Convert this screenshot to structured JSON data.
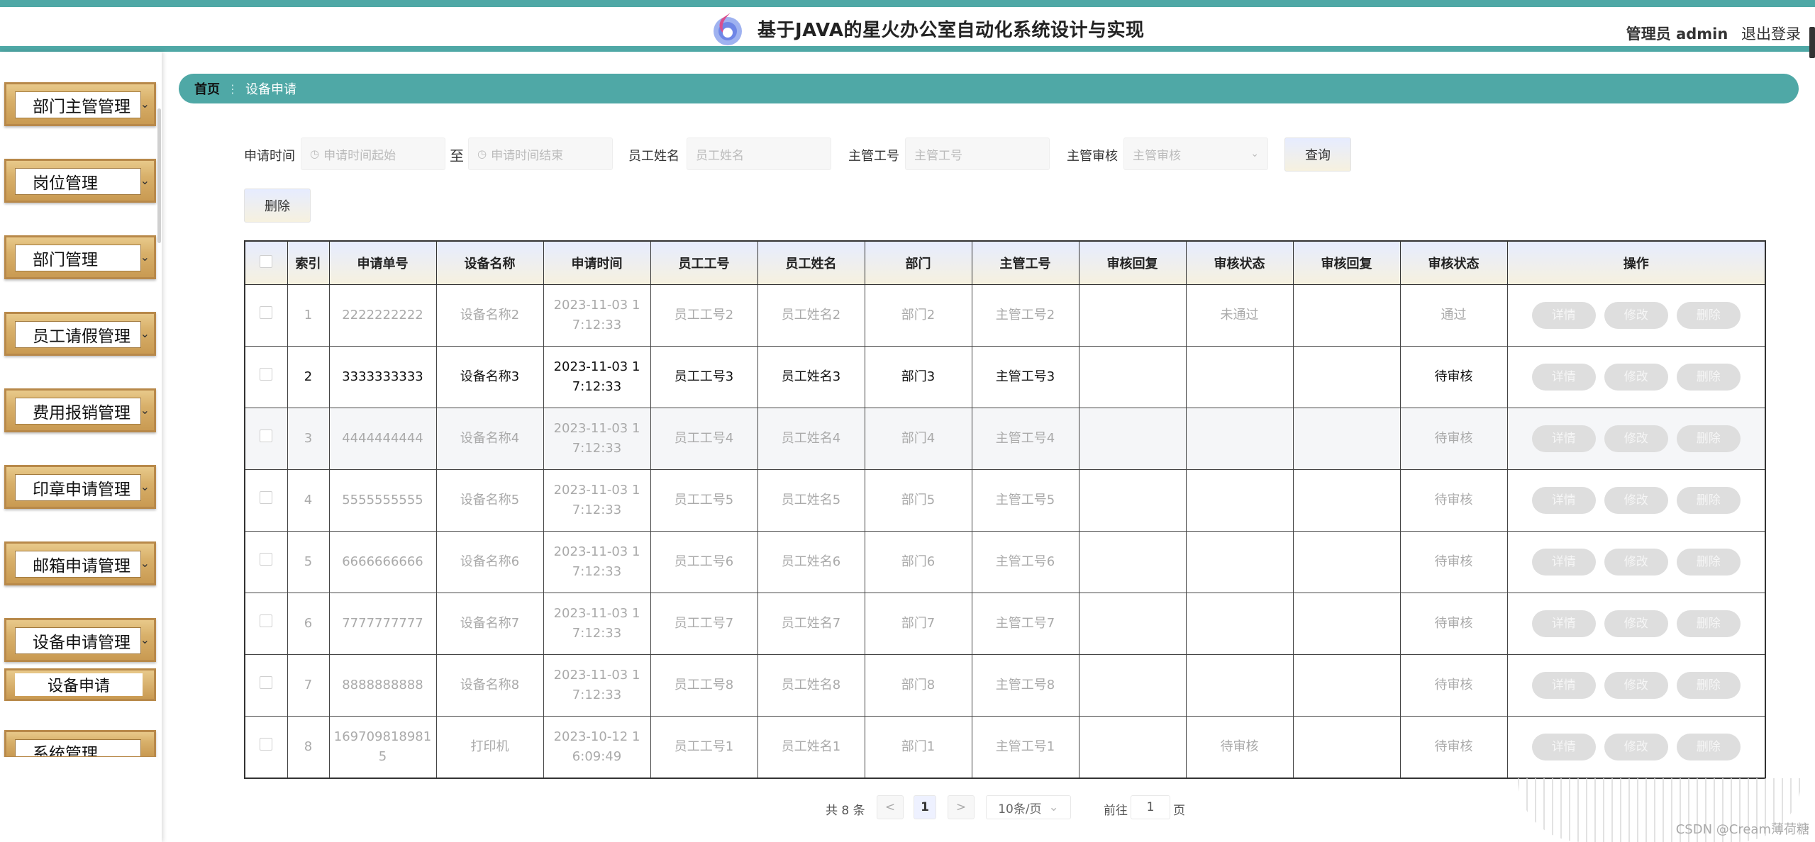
{
  "header": {
    "title": "基于JAVA的星火办公室自动化系统设计与实现",
    "role": "管理员 admin",
    "logout": "退出登录"
  },
  "sidebar": {
    "items": [
      {
        "label": "部门主管管理"
      },
      {
        "label": "岗位管理"
      },
      {
        "label": "部门管理"
      },
      {
        "label": "员工请假管理"
      },
      {
        "label": "费用报销管理"
      },
      {
        "label": "印章申请管理"
      },
      {
        "label": "邮箱申请管理"
      },
      {
        "label": "设备申请管理"
      },
      {
        "label": "系统管理"
      }
    ],
    "sub_item": "设备申请"
  },
  "breadcrumb": {
    "home": "首页",
    "current": "设备申请"
  },
  "search": {
    "time_label": "申请时间",
    "time_start_placeholder": "申请时间起始",
    "to": "至",
    "time_end_placeholder": "申请时间结束",
    "name_label": "员工姓名",
    "name_placeholder": "员工姓名",
    "mgr_no_label": "主管工号",
    "mgr_no_placeholder": "主管工号",
    "audit_label": "主管审核",
    "audit_placeholder": "主管审核",
    "query_button": "查询",
    "delete_button": "删除"
  },
  "table": {
    "columns": [
      "索引",
      "申请单号",
      "设备名称",
      "申请时间",
      "员工工号",
      "员工姓名",
      "部门",
      "主管工号",
      "审核回复",
      "审核状态",
      "审核回复",
      "审核状态",
      "操作"
    ],
    "rows": [
      {
        "idx": "1",
        "no": "2222222222",
        "device": "设备名称2",
        "time": "2023-11-03 17:12:33",
        "emp_no": "员工工号2",
        "emp_name": "员工姓名2",
        "dept": "部门2",
        "mgr_no": "主管工号2",
        "reply1": "",
        "status1": "未通过",
        "reply2": "",
        "status2": "通过"
      },
      {
        "idx": "2",
        "no": "3333333333",
        "device": "设备名称3",
        "time": "2023-11-03 17:12:33",
        "emp_no": "员工工号3",
        "emp_name": "员工姓名3",
        "dept": "部门3",
        "mgr_no": "主管工号3",
        "reply1": "",
        "status1": "",
        "reply2": "",
        "status2": "待审核"
      },
      {
        "idx": "3",
        "no": "4444444444",
        "device": "设备名称4",
        "time": "2023-11-03 17:12:33",
        "emp_no": "员工工号4",
        "emp_name": "员工姓名4",
        "dept": "部门4",
        "mgr_no": "主管工号4",
        "reply1": "",
        "status1": "",
        "reply2": "",
        "status2": "待审核"
      },
      {
        "idx": "4",
        "no": "5555555555",
        "device": "设备名称5",
        "time": "2023-11-03 17:12:33",
        "emp_no": "员工工号5",
        "emp_name": "员工姓名5",
        "dept": "部门5",
        "mgr_no": "主管工号5",
        "reply1": "",
        "status1": "",
        "reply2": "",
        "status2": "待审核"
      },
      {
        "idx": "5",
        "no": "6666666666",
        "device": "设备名称6",
        "time": "2023-11-03 17:12:33",
        "emp_no": "员工工号6",
        "emp_name": "员工姓名6",
        "dept": "部门6",
        "mgr_no": "主管工号6",
        "reply1": "",
        "status1": "",
        "reply2": "",
        "status2": "待审核"
      },
      {
        "idx": "6",
        "no": "7777777777",
        "device": "设备名称7",
        "time": "2023-11-03 17:12:33",
        "emp_no": "员工工号7",
        "emp_name": "员工姓名7",
        "dept": "部门7",
        "mgr_no": "主管工号7",
        "reply1": "",
        "status1": "",
        "reply2": "",
        "status2": "待审核"
      },
      {
        "idx": "7",
        "no": "8888888888",
        "device": "设备名称8",
        "time": "2023-11-03 17:12:33",
        "emp_no": "员工工号8",
        "emp_name": "员工姓名8",
        "dept": "部门8",
        "mgr_no": "主管工号8",
        "reply1": "",
        "status1": "",
        "reply2": "",
        "status2": "待审核"
      },
      {
        "idx": "8",
        "no": "1697098189815",
        "device": "打印机",
        "time": "2023-10-12 16:09:49",
        "emp_no": "员工工号1",
        "emp_name": "员工姓名1",
        "dept": "部门1",
        "mgr_no": "主管工号1",
        "reply1": "",
        "status1": "待审核",
        "reply2": "",
        "status2": "待审核"
      }
    ],
    "actions": {
      "detail": "详情",
      "edit": "修改",
      "delete": "删除"
    }
  },
  "pagination": {
    "total": "共 8 条",
    "prev": "<",
    "page": "1",
    "next": ">",
    "size": "10条/页",
    "goto": "前往",
    "goto_value": "1",
    "page_unit": "页"
  },
  "watermark": "CSDN @Cream薄荷糖"
}
